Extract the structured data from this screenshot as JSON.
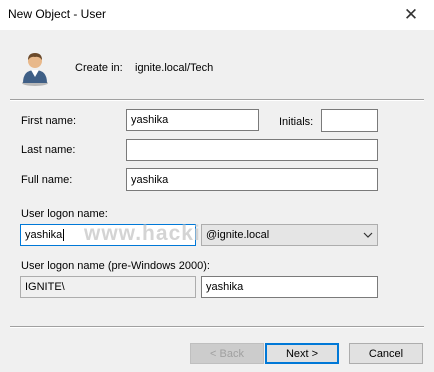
{
  "window": {
    "title": "New Object - User",
    "close_glyph": "✕"
  },
  "header": {
    "create_in_label": "Create in:",
    "create_in_value": "ignite.local/Tech"
  },
  "form": {
    "first_name_label": "First name:",
    "first_name_value": "yashika",
    "initials_label": "Initials:",
    "initials_value": "",
    "last_name_label": "Last name:",
    "last_name_value": "",
    "full_name_label": "Full name:",
    "full_name_value": "yashika",
    "logon_name_label": "User logon name:",
    "logon_name_value": "yashika",
    "domain_value": "@ignite.local",
    "pre2000_label": "User logon name (pre-Windows 2000):",
    "pre2000_domain": "IGNITE\\",
    "pre2000_name": "yashika"
  },
  "watermark": "www.hackingarticles.in",
  "buttons": {
    "back": "< Back",
    "next": "Next >",
    "cancel": "Cancel"
  },
  "colors": {
    "focus": "#0078d7",
    "dialog_bg": "#f0f0f0"
  }
}
